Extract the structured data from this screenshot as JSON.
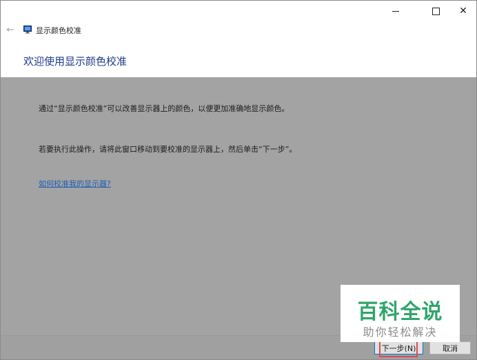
{
  "window": {
    "title": "显示颜色校准",
    "heading": "欢迎使用显示颜色校准",
    "back_icon": "←",
    "minimize_icon": "minimize-icon",
    "maximize_icon": "maximize-icon",
    "close_glyph": "✕"
  },
  "content": {
    "paragraph1": "通过“显示颜色校准”可以改善显示器上的颜色，以便更加准确地显示颜色。",
    "paragraph2": "若要执行此操作，请将此窗口移动到要校准的显示器上，然后单击“下一步”。",
    "help_link": "如何校准我的显示器?"
  },
  "footer": {
    "next_label": "下一步(N)",
    "cancel_label": "取消"
  },
  "watermark": {
    "title": "百科全说",
    "subtitle": "助你轻松解决"
  },
  "colors": {
    "content_bg": "#a3a3a3",
    "heading": "#1e3b8a",
    "link": "#1e5fb4",
    "highlight": "#e04a4a",
    "watermark_green": "#2fa56a"
  }
}
